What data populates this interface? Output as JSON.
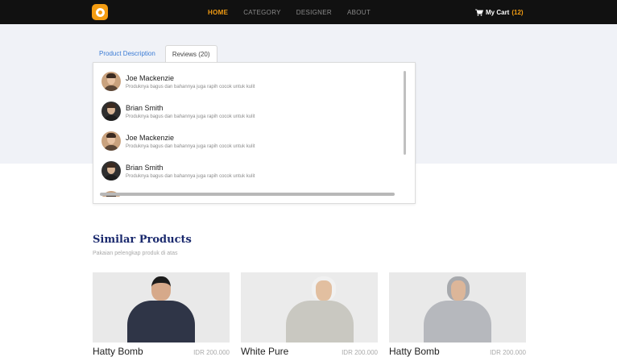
{
  "navbar": {
    "links": [
      {
        "label": "HOME",
        "active": true
      },
      {
        "label": "CATEGORY",
        "active": false
      },
      {
        "label": "DESIGNER",
        "active": false
      },
      {
        "label": "ABOUT",
        "active": false
      }
    ],
    "cart_label": "My Cart",
    "cart_count": "(12)",
    "accent": "#f39c12"
  },
  "tabs": {
    "description": "Product Description",
    "reviews": "Reviews (20)"
  },
  "reviews": [
    {
      "name": "Joe Mackenzie",
      "text": "Produknya bagus dan bahannya juga rapih cocok untuk kulit",
      "avatar": "tan"
    },
    {
      "name": "Brian Smith",
      "text": "Produknya bagus dan bahannya juga rapih cocok untuk kulit",
      "avatar": "dark"
    },
    {
      "name": "Joe Mackenzie",
      "text": "Produknya bagus dan bahannya juga rapih cocok untuk kulit",
      "avatar": "tan"
    },
    {
      "name": "Brian Smith",
      "text": "Produknya bagus dan bahannya juga rapih cocok untuk kulit",
      "avatar": "dark"
    }
  ],
  "similar": {
    "title": "Similar Products",
    "subtitle": "Pakaian pelengkap produk di atas",
    "products": [
      {
        "name": "Hatty Bomb",
        "price": "IDR 200.000"
      },
      {
        "name": "White Pure",
        "price": "IDR 200.000"
      },
      {
        "name": "Hatty Bomb",
        "price": "IDR 200.000"
      }
    ]
  }
}
